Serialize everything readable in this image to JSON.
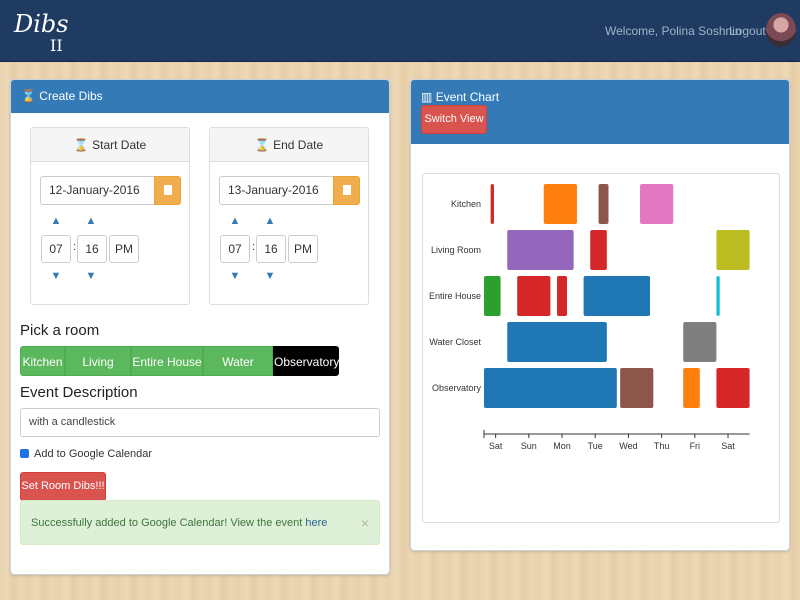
{
  "navbar": {
    "brand": "Dibs",
    "brand_suffix": "II",
    "welcome": "Welcome, Polina Soshnin",
    "logout": "Logout"
  },
  "create": {
    "title": "Create Dibs",
    "start": {
      "header": "Start Date",
      "date": "12-January-2016",
      "hour": "07",
      "minute": "16",
      "period": "PM"
    },
    "end": {
      "header": "End Date",
      "date": "13-January-2016",
      "hour": "07",
      "minute": "16",
      "period": "PM"
    },
    "room_label": "Pick a room",
    "rooms": [
      "Kitchen",
      "Living Room",
      "Entire House",
      "Water Closet",
      "Observatory"
    ],
    "selected_room": "Observatory",
    "desc_label": "Event Description",
    "description": "with a candlestick",
    "google_label": "Add to Google Calendar",
    "google_checked": true,
    "submit_label": "Set Room Dibs!!!",
    "alert_text": "Successfully added to Google Calendar! View the event",
    "alert_link": "here",
    "alert_close": "×"
  },
  "event_chart": {
    "title": "Event Chart",
    "switch_label": "Switch View"
  },
  "chart_data": {
    "type": "timeline",
    "rooms": [
      "Kitchen",
      "Living Room",
      "Entire House",
      "Water Closet",
      "Observatory"
    ],
    "days": [
      "Sat",
      "Sun",
      "Mon",
      "Tue",
      "Wed",
      "Thu",
      "Fri",
      "Sat"
    ],
    "events": [
      {
        "room": "Kitchen",
        "start": 0.2,
        "end": 0.3,
        "color": "#d62728"
      },
      {
        "room": "Kitchen",
        "start": 1.8,
        "end": 2.8,
        "color": "#ff7f0e"
      },
      {
        "room": "Kitchen",
        "start": 3.45,
        "end": 3.75,
        "color": "#8c564b"
      },
      {
        "room": "Kitchen",
        "start": 4.7,
        "end": 5.7,
        "color": "#e377c2"
      },
      {
        "room": "Living Room",
        "start": 0.7,
        "end": 2.7,
        "color": "#9467bd"
      },
      {
        "room": "Living Room",
        "start": 3.2,
        "end": 3.7,
        "color": "#d62728"
      },
      {
        "room": "Living Room",
        "start": 7.0,
        "end": 8.0,
        "color": "#bcbd22"
      },
      {
        "room": "Entire House",
        "start": 0.0,
        "end": 0.5,
        "color": "#2ca02c"
      },
      {
        "room": "Entire House",
        "start": 1.0,
        "end": 2.0,
        "color": "#d62728"
      },
      {
        "room": "Entire House",
        "start": 2.2,
        "end": 2.5,
        "color": "#d62728"
      },
      {
        "room": "Entire House",
        "start": 3.0,
        "end": 5.0,
        "color": "#1f77b4"
      },
      {
        "room": "Entire House",
        "start": 7.0,
        "end": 7.1,
        "color": "#17becf"
      },
      {
        "room": "Water Closet",
        "start": 0.7,
        "end": 3.7,
        "color": "#1f77b4"
      },
      {
        "room": "Water Closet",
        "start": 6.0,
        "end": 7.0,
        "color": "#7f7f7f"
      },
      {
        "room": "Observatory",
        "start": 0.0,
        "end": 4.0,
        "color": "#1f77b4"
      },
      {
        "room": "Observatory",
        "start": 4.1,
        "end": 5.1,
        "color": "#8c564b"
      },
      {
        "room": "Observatory",
        "start": 6.0,
        "end": 6.5,
        "color": "#ff7f0e"
      },
      {
        "room": "Observatory",
        "start": 7.0,
        "end": 8.0,
        "color": "#d62728"
      }
    ]
  }
}
